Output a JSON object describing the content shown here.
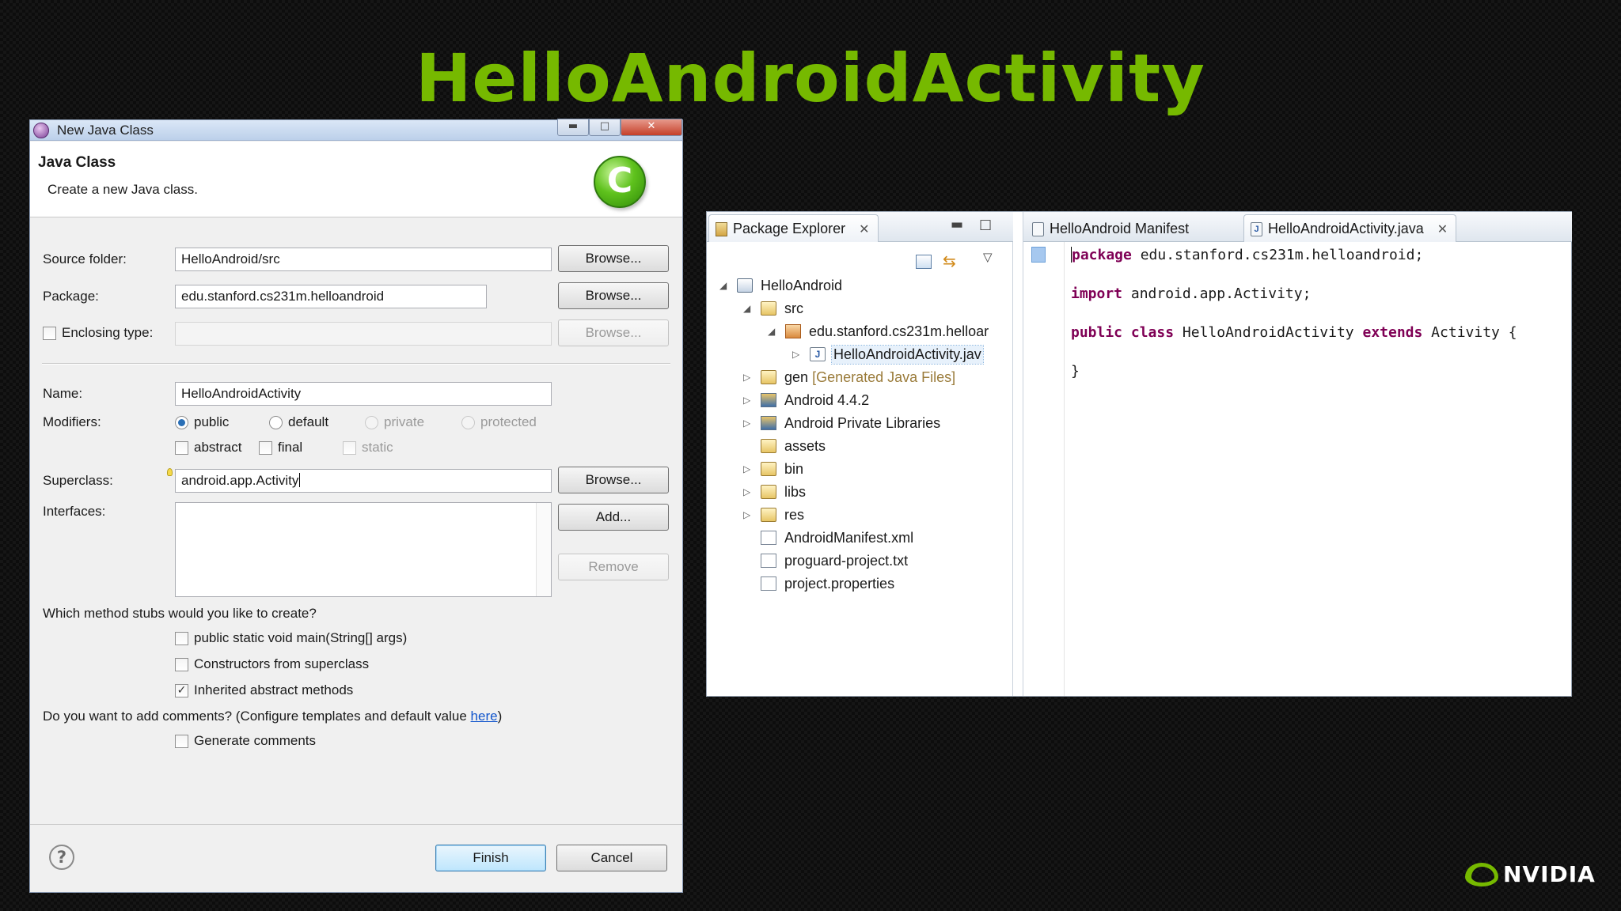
{
  "slide": {
    "title": "HelloAndroidActivity",
    "brand": "NVIDIA"
  },
  "dialog": {
    "title": "New Java Class",
    "header_title": "Java Class",
    "header_desc": "Create a new Java class.",
    "class_icon_letter": "C",
    "source_folder": {
      "label": "Source folder:",
      "value": "HelloAndroid/src",
      "button": "Browse..."
    },
    "package": {
      "label": "Package:",
      "value": "edu.stanford.cs231m.helloandroid",
      "button": "Browse..."
    },
    "enclosing": {
      "label": "Enclosing type:",
      "value": "",
      "button": "Browse...",
      "checked": false
    },
    "name": {
      "label": "Name:",
      "value": "HelloAndroidActivity"
    },
    "modifiers": {
      "label": "Modifiers:",
      "access": [
        "public",
        "default",
        "private",
        "protected"
      ],
      "selected": "public",
      "flags": [
        "abstract",
        "final",
        "static"
      ]
    },
    "superclass": {
      "label": "Superclass:",
      "value": "android.app.Activity",
      "button": "Browse..."
    },
    "interfaces": {
      "label": "Interfaces:",
      "add": "Add...",
      "remove": "Remove"
    },
    "stubs": {
      "question": "Which method stubs would you like to create?",
      "options": [
        {
          "label": "public static void main(String[] args)",
          "checked": false
        },
        {
          "label": "Constructors from superclass",
          "checked": false
        },
        {
          "label": "Inherited abstract methods",
          "checked": true
        }
      ]
    },
    "comments": {
      "question_pre": "Do you want to add comments? (Configure templates and default value ",
      "link": "here",
      "question_post": ")",
      "option": "Generate comments"
    },
    "buttons": {
      "finish": "Finish",
      "cancel": "Cancel",
      "help": "?"
    }
  },
  "ide": {
    "package_explorer": {
      "tab": "Package Explorer",
      "tree": [
        {
          "label": "HelloAndroid",
          "icon": "project-icon",
          "expanded": true
        },
        {
          "label": "src",
          "icon": "folder-icon",
          "expanded": true
        },
        {
          "label": "edu.stanford.cs231m.helloar",
          "icon": "package-icon",
          "expanded": true
        },
        {
          "label": "HelloAndroidActivity.jav",
          "icon": "java-file-icon",
          "expanded": false
        },
        {
          "label": "gen",
          "suffix": "[Generated Java Files]",
          "icon": "folder-icon",
          "expanded": false
        },
        {
          "label": "Android 4.4.2",
          "icon": "library-icon",
          "expanded": false
        },
        {
          "label": "Android Private Libraries",
          "icon": "library-icon",
          "expanded": false
        },
        {
          "label": "assets",
          "icon": "folder-icon",
          "expanded": false
        },
        {
          "label": "bin",
          "icon": "folder-icon",
          "expanded": false
        },
        {
          "label": "libs",
          "icon": "folder-icon",
          "expanded": false
        },
        {
          "label": "res",
          "icon": "folder-icon",
          "expanded": false
        },
        {
          "label": "AndroidManifest.xml",
          "icon": "manifest-file-icon",
          "expanded": false
        },
        {
          "label": "proguard-project.txt",
          "icon": "text-file-icon",
          "expanded": false
        },
        {
          "label": "project.properties",
          "icon": "text-file-icon",
          "expanded": false
        }
      ]
    },
    "editor": {
      "tabs": [
        {
          "label": "HelloAndroid Manifest",
          "active": false
        },
        {
          "label": "HelloAndroidActivity.java",
          "active": true
        }
      ],
      "code": {
        "line1_kw": "package",
        "line1_rest": " edu.stanford.cs231m.helloandroid;",
        "line2_kw": "import",
        "line2_rest": " android.app.Activity;",
        "line3_kw1": "public",
        "line3_kw2": "class",
        "line3_name": " HelloAndroidActivity ",
        "line3_kw3": "extends",
        "line3_rest": " Activity {",
        "line4": "}"
      }
    }
  },
  "colors": {
    "title_green": "#76b900",
    "keyword": "#7f0055",
    "link": "#1155cc"
  }
}
